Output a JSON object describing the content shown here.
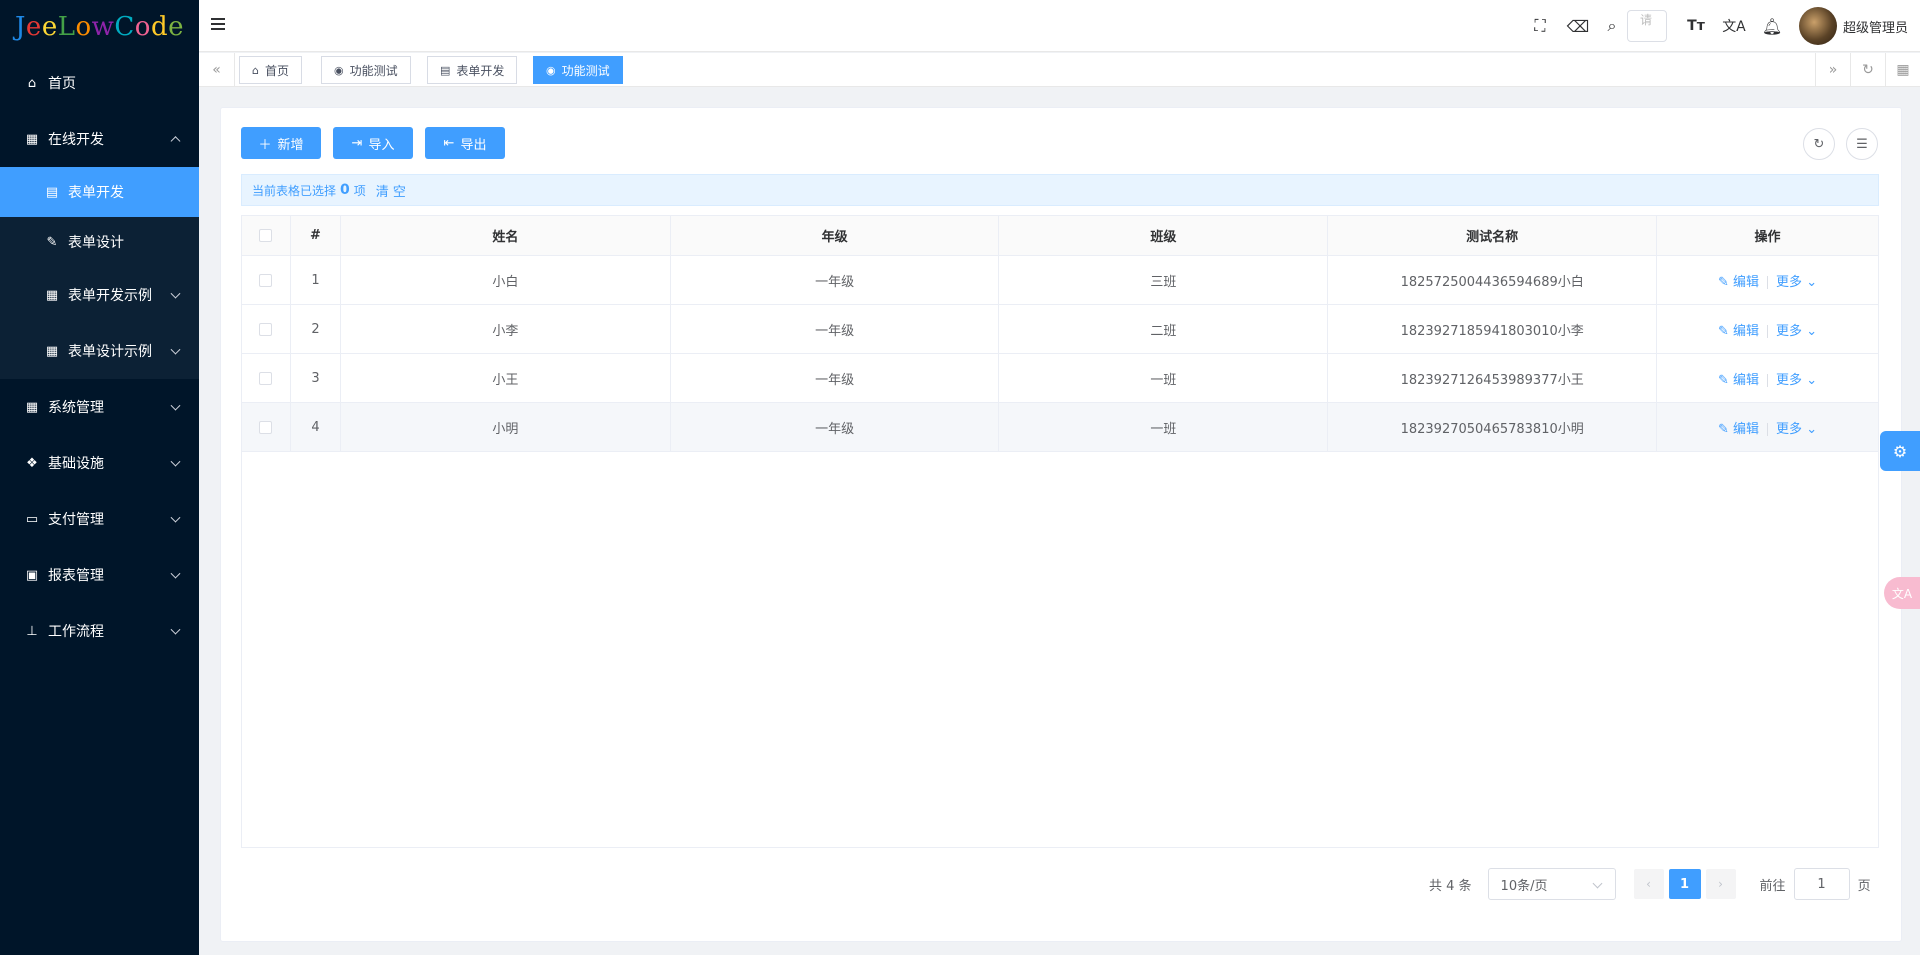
{
  "logo": {
    "text": "JeeLowCode",
    "colors": [
      "#1e88e5",
      "#e53935",
      "#fdd835",
      "#43a047",
      "#fb8c00",
      "#8e24aa",
      "#00acc1",
      "#f06292",
      "#ffca28",
      "#7cb342"
    ]
  },
  "sidebar": {
    "items": [
      {
        "label": "首页",
        "icon": "home-icon"
      },
      {
        "label": "在线开发",
        "icon": "dev-icon",
        "expanded": true,
        "children": [
          {
            "label": "表单开发",
            "icon": "form-icon",
            "active": true
          },
          {
            "label": "表单设计",
            "icon": "edit-icon"
          },
          {
            "label": "表单开发示例",
            "icon": "table-icon"
          },
          {
            "label": "表单设计示例",
            "icon": "table-icon"
          }
        ]
      },
      {
        "label": "系统管理",
        "icon": "grid-icon"
      },
      {
        "label": "基础设施",
        "icon": "cubes-icon"
      },
      {
        "label": "支付管理",
        "icon": "card-icon"
      },
      {
        "label": "报表管理",
        "icon": "report-icon"
      },
      {
        "label": "工作流程",
        "icon": "flow-icon"
      }
    ]
  },
  "header": {
    "search_placeholder": "请",
    "username": "超级管理员"
  },
  "tabs": [
    {
      "label": "首页",
      "icon": "home-icon"
    },
    {
      "label": "功能测试",
      "icon": "eye-icon"
    },
    {
      "label": "表单开发",
      "icon": "form-icon"
    },
    {
      "label": "功能测试",
      "icon": "eye-icon",
      "active": true
    }
  ],
  "toolbar": {
    "add": "新增",
    "import": "导入",
    "export": "导出"
  },
  "selection": {
    "prefix": "当前表格已选择",
    "count": "0",
    "suffix": "项",
    "clear": "清 空"
  },
  "table": {
    "columns": [
      "#",
      "姓名",
      "年级",
      "班级",
      "测试名称",
      "操作"
    ],
    "rows": [
      {
        "no": "1",
        "name": "小白",
        "grade": "一年级",
        "cls": "三班",
        "test": "1825725004436594689小白"
      },
      {
        "no": "2",
        "name": "小李",
        "grade": "一年级",
        "cls": "二班",
        "test": "1823927185941803010小李"
      },
      {
        "no": "3",
        "name": "小王",
        "grade": "一年级",
        "cls": "一班",
        "test": "1823927126453989377小王"
      },
      {
        "no": "4",
        "name": "小明",
        "grade": "一年级",
        "cls": "一班",
        "test": "1823927050465783810小明"
      }
    ],
    "edit_label": "编辑",
    "more_label": "更多"
  },
  "pagination": {
    "total": "共 4 条",
    "page_size": "10条/页",
    "current": "1",
    "goto": "前往",
    "goto_value": "1",
    "page_suffix": "页"
  }
}
